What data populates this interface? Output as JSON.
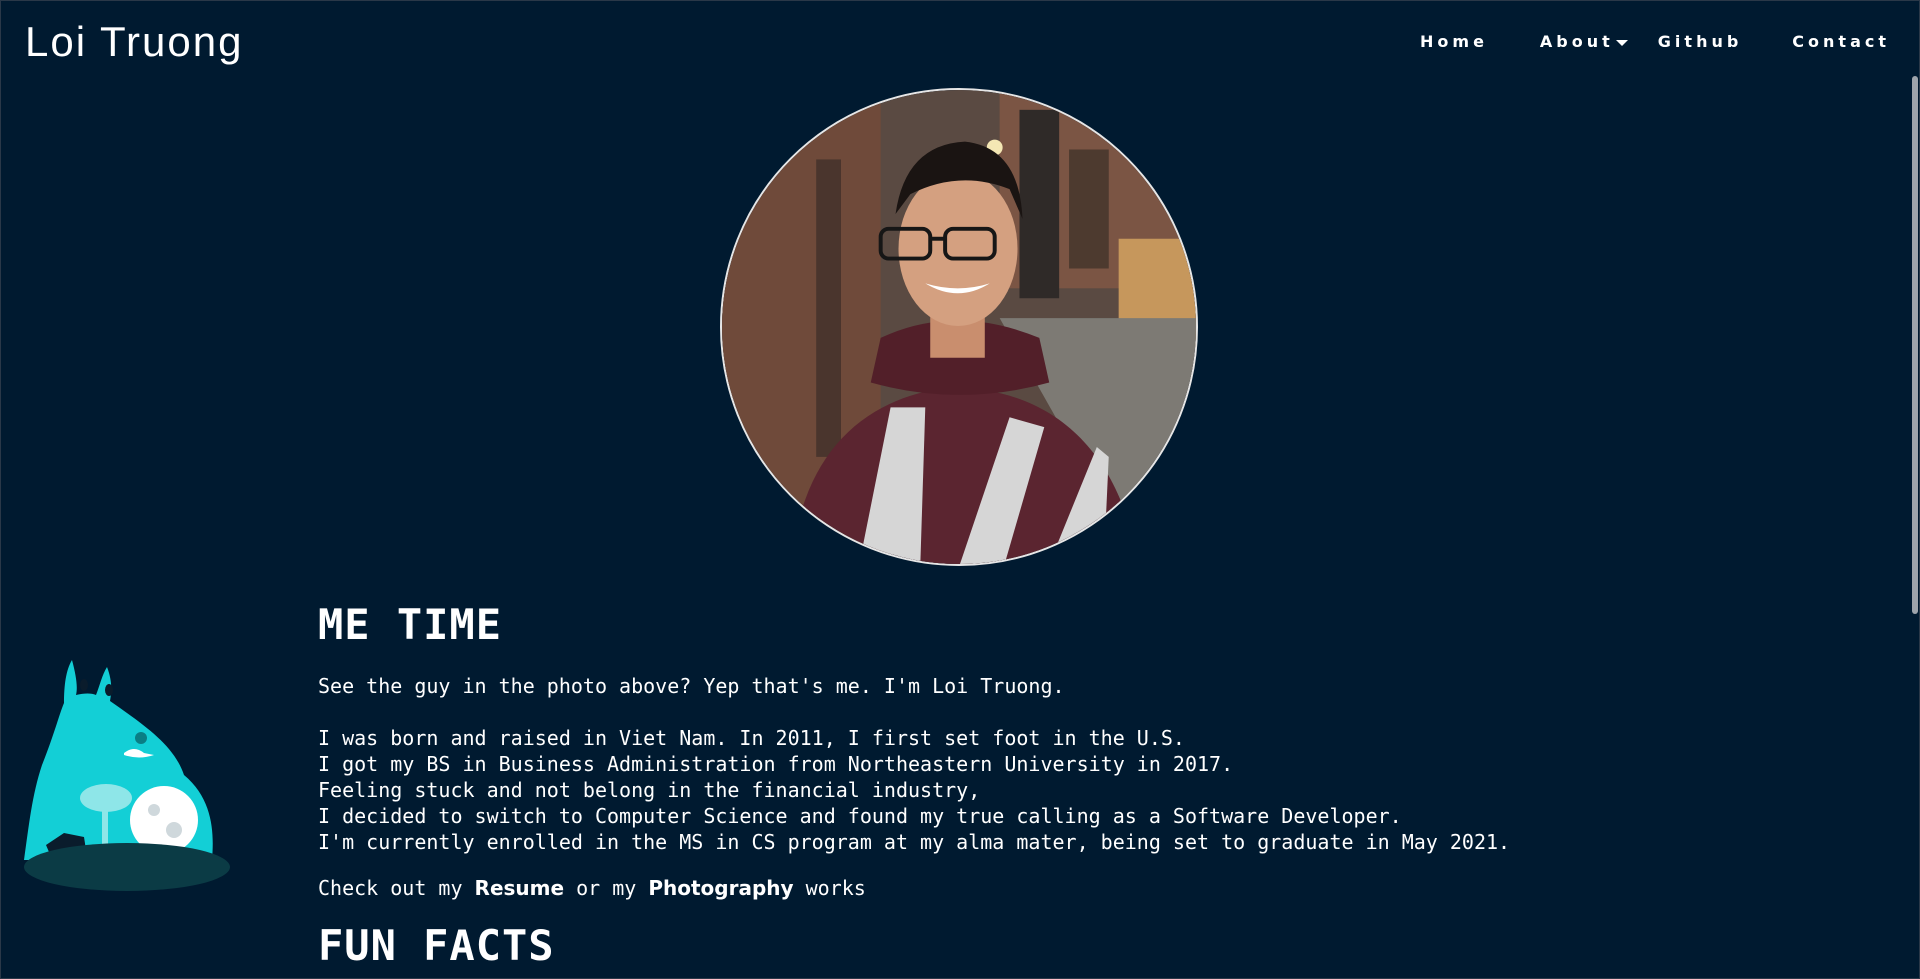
{
  "header": {
    "brand": "Loi Truong",
    "nav": {
      "home": "Home",
      "about": "About",
      "github": "Github",
      "contact": "Contact"
    }
  },
  "main": {
    "section_title": "ME TIME",
    "intro": "See the guy in the photo above? Yep that's me. I'm Loi Truong.",
    "bio_lines": [
      "I was born and raised in Viet Nam. In 2011, I first set foot in the U.S.",
      "I got my BS in Business Administration from Northeastern University in 2017.",
      "Feeling stuck and not belong in the financial industry,",
      "I decided to switch to Computer Science and found my true calling as a Software Developer.",
      "I'm currently enrolled in the MS in CS program at my alma mater, being set to graduate in May 2021."
    ],
    "links_text": {
      "prefix": "Check out my ",
      "resume": "Resume",
      "middle": " or my ",
      "photography": "Photography",
      "suffix": " works"
    },
    "next_section_title": "FUN FACTS"
  },
  "colors": {
    "background": "#001a30",
    "text": "#ffffff",
    "totoro": "#13cfd6"
  },
  "icons": {
    "profile_photo": "profile-photo",
    "totoro_illustration": "totoro-illustration",
    "dropdown": "chevron-down-icon"
  }
}
